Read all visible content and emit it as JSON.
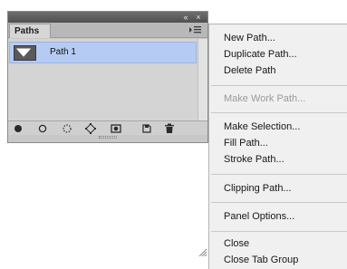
{
  "panel": {
    "titlebar": {
      "collapse_glyph": "«",
      "close_glyph": "×"
    },
    "tab_label": "Paths",
    "menu_button_icon": "panel-menu-icon",
    "paths": [
      {
        "name": "Path 1",
        "selected": true
      }
    ],
    "bottom_icons": [
      "fill-path-icon",
      "stroke-path-icon",
      "load-selection-icon",
      "make-work-path-icon",
      "add-mask-icon",
      "new-path-icon",
      "delete-path-icon"
    ],
    "selected_row_color": "#b6cbf3"
  },
  "menu": {
    "items": [
      "New Path...",
      "Duplicate Path...",
      "Delete Path",
      "Make Work Path...",
      "Make Selection...",
      "Fill Path...",
      "Stroke Path...",
      "Clipping Path...",
      "Panel Options...",
      "Close",
      "Close Tab Group"
    ],
    "disabled_item": "Make Work Path..."
  }
}
